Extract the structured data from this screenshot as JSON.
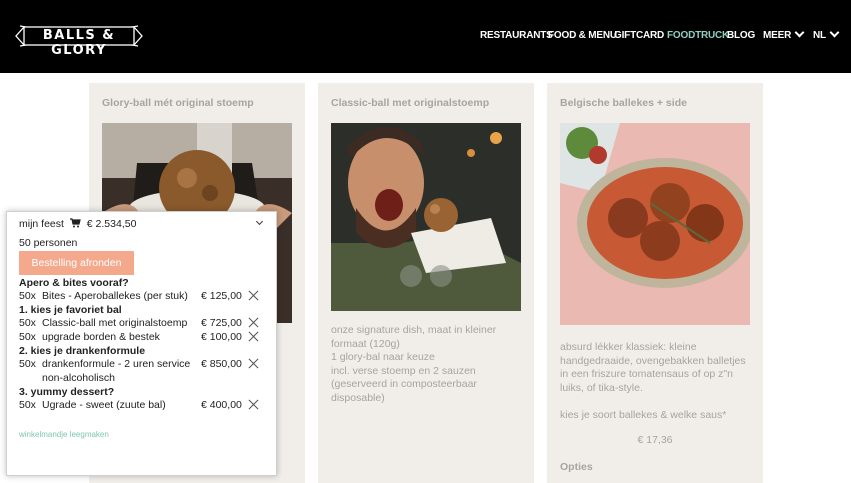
{
  "header": {
    "logo_text": "BALLS & GLORY",
    "nav": [
      "RESTAURANTS",
      "FOOD & MENU",
      "GIFTCARD",
      "FOODTRUCK",
      "BLOG",
      "MEER",
      "NL"
    ],
    "active": "FOODTRUCK",
    "active_color": "#8fcfbf"
  },
  "cards": [
    {
      "title": "Glory-ball mét original stoemp"
    },
    {
      "title": "Classic-ball met originalstoemp",
      "desc": [
        "onze signature dish, maat in kleiner",
        "formaat (120g)",
        "1 glory-bal naar keuze",
        "incl. verse stoemp en 2 sauzen",
        "(geserveerd in composteerbaar",
        "disposable)"
      ]
    },
    {
      "title": "Belgische ballekes + side",
      "desc": [
        "absurd lékker klassiek: kleine",
        "handgedraaide, ovengebakken balletjes",
        "in een friszure tomatensaus of op z\"n",
        "luiks, of tika-style.",
        "",
        "kies je soort ballekes & welke saus*"
      ],
      "price": "€ 17,36",
      "options": "Opties"
    }
  ],
  "cart": {
    "name": "mijn feest",
    "cart_icon": "shopping-cart-icon",
    "total": "€ 2.534,50",
    "persons": "50 personen",
    "checkout": "Bestelling afronden",
    "sections": [
      {
        "title": "Apero & bites vooraf?",
        "items": [
          {
            "qty": "50x",
            "name": "Bites - Aperoballekes (per stuk)",
            "price": "€ 125,00"
          }
        ]
      },
      {
        "title": "1. kies je favoriet bal",
        "items": [
          {
            "qty": "50x",
            "name": "Classic-ball met originalstoemp",
            "price": "€ 725,00"
          },
          {
            "qty": "50x",
            "name": "upgrade borden & bestek",
            "price": "€ 100,00"
          }
        ]
      },
      {
        "title": "2. kies je drankenformule",
        "items": [
          {
            "qty": "50x",
            "name": "drankenformule - 2 uren service non-alcoholisch",
            "price": "€ 850,00"
          }
        ]
      },
      {
        "title": "3. yummy dessert?",
        "items": [
          {
            "qty": "50x",
            "name": "Ugrade - sweet (zuute bal)",
            "price": "€ 400,00"
          }
        ]
      }
    ],
    "clear": "winkelmandje leegmaken",
    "accent": "#f5a98c"
  }
}
